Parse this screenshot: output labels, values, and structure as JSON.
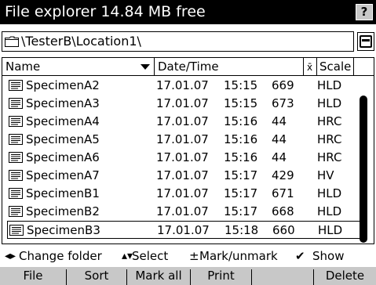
{
  "title": "File explorer 14.84 MB free",
  "help_label": "?",
  "path": "\\TesterB\\Location1\\",
  "icons": {
    "folder": "folder-icon",
    "path_button": "window-icon",
    "file": "document-icon",
    "sort": "sort-down-icon"
  },
  "columns": {
    "name": "Name",
    "datetime": "Date/Time",
    "mean": "x̄",
    "scale": "Scale"
  },
  "files": [
    {
      "name": "SpecimenA2",
      "date": "17.01.07",
      "time": "15:15",
      "value": "669",
      "scale": "HLD"
    },
    {
      "name": "SpecimenA3",
      "date": "17.01.07",
      "time": "15:15",
      "value": "673",
      "scale": "HLD"
    },
    {
      "name": "SpecimenA4",
      "date": "17.01.07",
      "time": "15:16",
      "value": "44",
      "scale": "HRC"
    },
    {
      "name": "SpecimenA5",
      "date": "17.01.07",
      "time": "15:16",
      "value": "44",
      "scale": "HRC"
    },
    {
      "name": "SpecimenA6",
      "date": "17.01.07",
      "time": "15:16",
      "value": "44",
      "scale": "HRC"
    },
    {
      "name": "SpecimenA7",
      "date": "17.01.07",
      "time": "15:17",
      "value": "429",
      "scale": "HV"
    },
    {
      "name": "SpecimenB1",
      "date": "17.01.07",
      "time": "15:17",
      "value": "671",
      "scale": "HLD"
    },
    {
      "name": "SpecimenB2",
      "date": "17.01.07",
      "time": "15:17",
      "value": "668",
      "scale": "HLD"
    },
    {
      "name": "SpecimenB3",
      "date": "17.01.07",
      "time": "15:18",
      "value": "660",
      "scale": "HLD",
      "selected": true
    }
  ],
  "hints": {
    "change_folder_icon": "◂▸",
    "change_folder": "Change folder",
    "select_icon": "▴▾",
    "select": "Select",
    "mark_icon": "±",
    "mark": "Mark/unmark",
    "show_icon": "✔",
    "show": "Show"
  },
  "softkeys": {
    "file": "File",
    "sort": "Sort",
    "mark_all": "Mark all",
    "print": "Print",
    "empty": "",
    "delete": "Delete"
  },
  "colors": {
    "titlebar_bg": "#000000",
    "titlebar_fg": "#ffffff",
    "softkey_bg": "#c8c8c8"
  }
}
